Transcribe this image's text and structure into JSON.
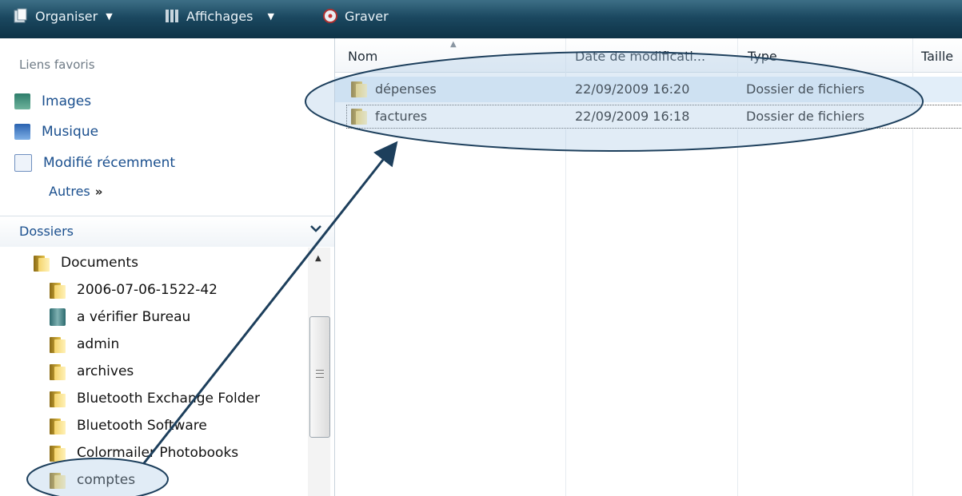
{
  "toolbar": {
    "organise_label": "Organiser",
    "views_label": "Affichages",
    "burn_label": "Graver"
  },
  "favorites": {
    "title": "Liens favoris",
    "items": [
      {
        "label": "Images",
        "icon": "images-icon"
      },
      {
        "label": "Musique",
        "icon": "music-icon"
      },
      {
        "label": "Modifié récemment",
        "icon": "recent-icon"
      }
    ],
    "more_label": "Autres",
    "more_glyph": "»"
  },
  "folders": {
    "title": "Dossiers",
    "tree": [
      {
        "label": "Documents",
        "icon": "folder-icon"
      },
      {
        "label": "2006-07-06-1522-42",
        "icon": "folder-icon"
      },
      {
        "label": "a vérifier Bureau",
        "icon": "book-icon"
      },
      {
        "label": "admin",
        "icon": "folder-icon"
      },
      {
        "label": "archives",
        "icon": "folder-icon"
      },
      {
        "label": "Bluetooth Exchange Folder",
        "icon": "folder-icon"
      },
      {
        "label": "Bluetooth Software",
        "icon": "folder-icon"
      },
      {
        "label": "Colormailer Photobooks",
        "icon": "folder-icon"
      },
      {
        "label": "comptes",
        "icon": "folder-icon"
      }
    ]
  },
  "file_list": {
    "columns": [
      "Nom",
      "Date de modificati...",
      "Type",
      "Taille"
    ],
    "rows": [
      {
        "name": "dépenses",
        "date": "22/09/2009 16:20",
        "type": "Dossier de fichiers",
        "size": ""
      },
      {
        "name": "factures",
        "date": "22/09/2009 16:18",
        "type": "Dossier de fichiers",
        "size": ""
      }
    ]
  },
  "colors": {
    "toolbar": "#1b4860",
    "link": "#1a4f8e",
    "selection": "#e2eef9",
    "annotation_fill": "#a9c9e4",
    "annotation_stroke": "#1d3f5c"
  }
}
